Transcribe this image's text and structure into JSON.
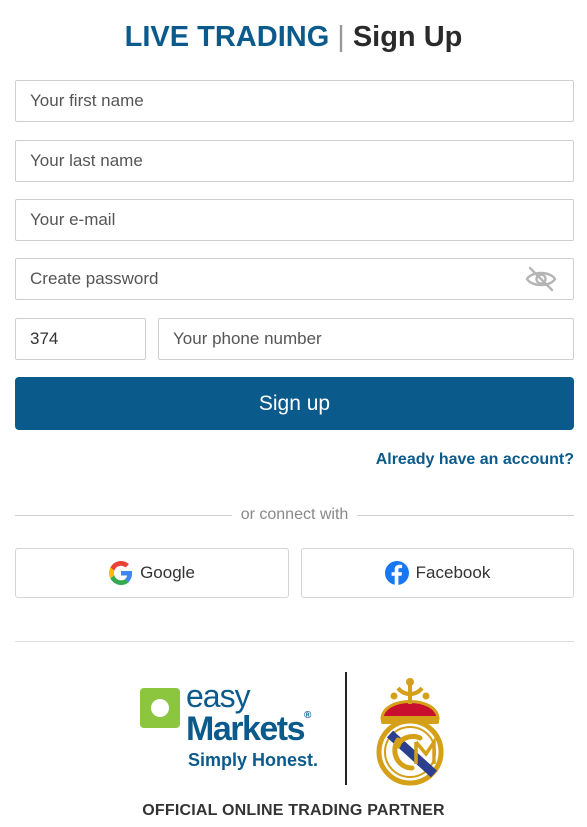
{
  "header": {
    "title_part1": "LIVE TRADING",
    "separator": "|",
    "title_part2": "Sign Up"
  },
  "form": {
    "first_name_placeholder": "Your first name",
    "last_name_placeholder": "Your last name",
    "email_placeholder": "Your e-mail",
    "password_placeholder": "Create password",
    "phone_code_value": "374",
    "phone_placeholder": "Your phone number",
    "signup_label": "Sign up",
    "have_account_link": "Already have an account?"
  },
  "social": {
    "divider_text": "or connect with",
    "google_label": "Google",
    "facebook_label": "Facebook"
  },
  "footer": {
    "brand_easy": "easy",
    "brand_markets": "Markets",
    "brand_reg": "®",
    "brand_slogan": "Simply Honest.",
    "partner_text": "OFFICIAL ONLINE TRADING PARTNER"
  },
  "icons": {
    "password_toggle": "eye-slash-icon",
    "google": "google-icon",
    "facebook": "facebook-icon"
  },
  "colors": {
    "primary": "#0b5a8c",
    "google_blue": "#4285F4",
    "google_red": "#EA4335",
    "google_yellow": "#FBBC05",
    "google_green": "#34A853",
    "facebook_blue": "#1877F2",
    "easymarkets_green": "#8cc63f"
  }
}
